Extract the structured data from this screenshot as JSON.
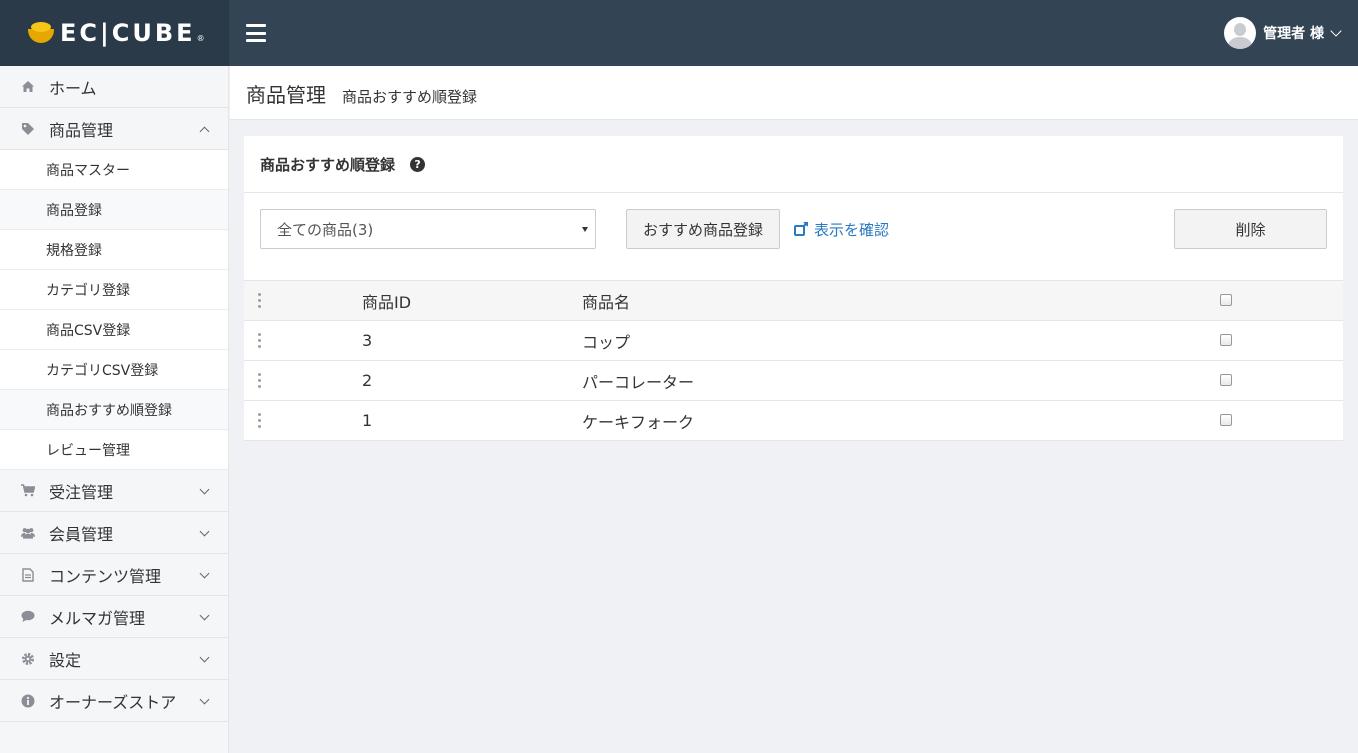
{
  "brand": {
    "logo_text": "EC|CUBE",
    "logo_reg": "®"
  },
  "user": {
    "name": "管理者 様"
  },
  "sidebar": {
    "items": [
      {
        "label": "ホーム",
        "icon": "home-icon"
      },
      {
        "label": "商品管理",
        "icon": "tag-icon",
        "expanded": true,
        "children": [
          "商品マスター",
          "商品登録",
          "規格登録",
          "カテゴリ登録",
          "商品CSV登録",
          "カテゴリCSV登録",
          "商品おすすめ順登録",
          "レビュー管理"
        ]
      },
      {
        "label": "受注管理",
        "icon": "cart-icon"
      },
      {
        "label": "会員管理",
        "icon": "users-icon"
      },
      {
        "label": "コンテンツ管理",
        "icon": "document-icon"
      },
      {
        "label": "メルマガ管理",
        "icon": "comment-icon"
      },
      {
        "label": "設定",
        "icon": "gear-icon"
      },
      {
        "label": "オーナーズストア",
        "icon": "info-icon"
      }
    ]
  },
  "page": {
    "title": "商品管理",
    "subtitle": "商品おすすめ順登録"
  },
  "card": {
    "title": "商品おすすめ順登録",
    "help_icon": "?",
    "select_value": "全ての商品(3)",
    "recommend_button": "おすすめ商品登録",
    "view_link": "表示を確認",
    "delete_button": "削除"
  },
  "table": {
    "headers": {
      "id": "商品ID",
      "name": "商品名"
    },
    "rows": [
      {
        "id": "3",
        "name": "コップ"
      },
      {
        "id": "2",
        "name": "パーコレーター"
      },
      {
        "id": "1",
        "name": "ケーキフォーク"
      }
    ]
  }
}
